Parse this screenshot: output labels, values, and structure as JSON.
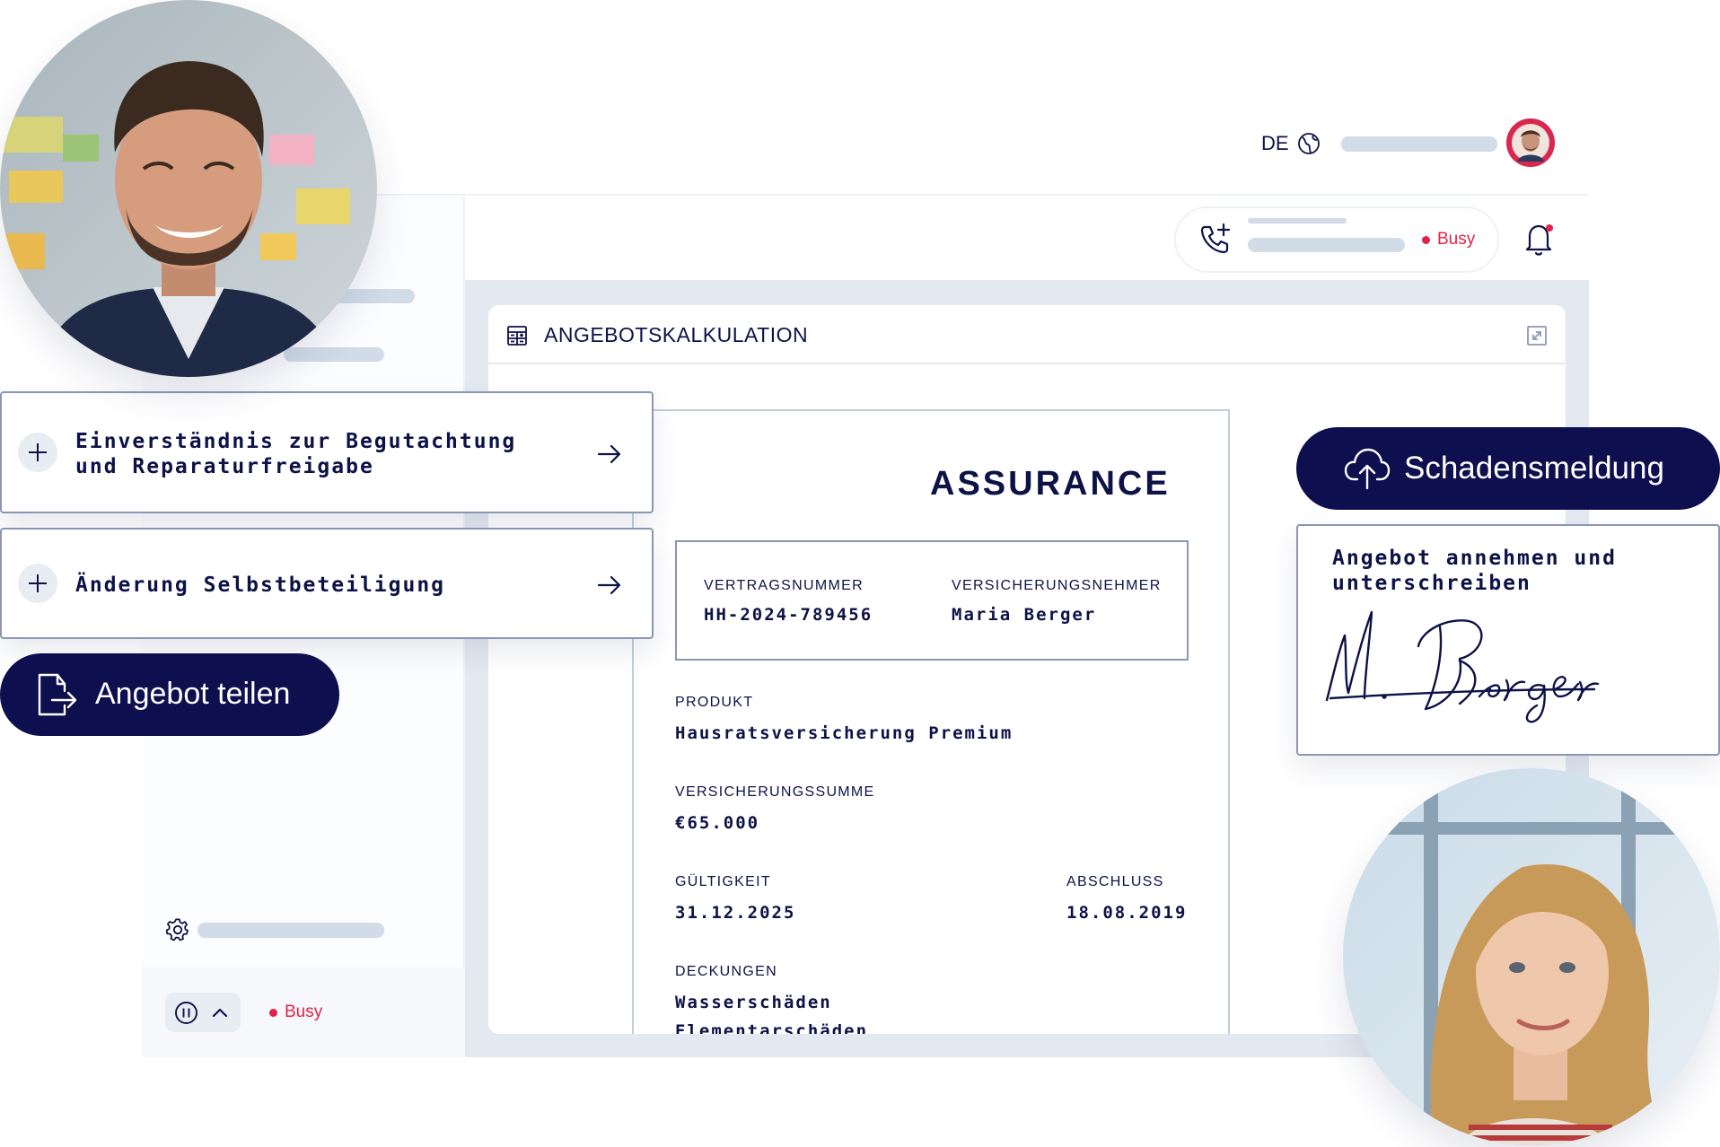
{
  "header": {
    "language": "DE",
    "globe_icon": "globe-icon",
    "user_avatar": "user-avatar"
  },
  "call": {
    "phone_icon": "phone-plus-icon",
    "status": "Busy",
    "bell_icon": "bell-icon"
  },
  "panel": {
    "title": "ANGEBOTSKALKULATION",
    "title_icon": "calculator-icon",
    "expand_icon": "expand-icon"
  },
  "document": {
    "brand": "ASSURANCE",
    "contract_number_label": "VERTRAGSNUMMER",
    "contract_number": "HH-2024-789456",
    "policyholder_label": "VERSICHERUNGSNEHMER",
    "policyholder": "Maria Berger",
    "product_label": "PRODUKT",
    "product": "Hausratsversicherung Premium",
    "sum_insured_label": "VERSICHERUNGSSUMME",
    "sum_insured": "€65.000",
    "validity_label": "GÜLTIGKEIT",
    "validity": "31.12.2025",
    "closing_label": "ABSCHLUSS",
    "closing": "18.08.2019",
    "coverage_label": "DECKUNGEN",
    "coverage": [
      "Wasserschäden",
      "Elementarschäden"
    ]
  },
  "actions": {
    "consent_line1": "Einverständnis zur Begutachtung",
    "consent_line2": "und Reparaturfreigabe",
    "deductible": "Änderung Selbstbeteiligung",
    "share": "Angebot teilen",
    "claim": "Schadensmeldung",
    "sign_line1": "Angebot annehmen und",
    "sign_line2": "unterschreiben",
    "signature": "M. Berger"
  },
  "footer": {
    "settings_icon": "gear-icon",
    "pause_icon": "pause-icon",
    "chevron_icon": "chevron-up-icon",
    "status": "Busy"
  },
  "colors": {
    "navy": "#0d0f4f",
    "busy": "#e0224a",
    "canvas": "#e3e9f1",
    "placeholder": "#d2dce8"
  }
}
